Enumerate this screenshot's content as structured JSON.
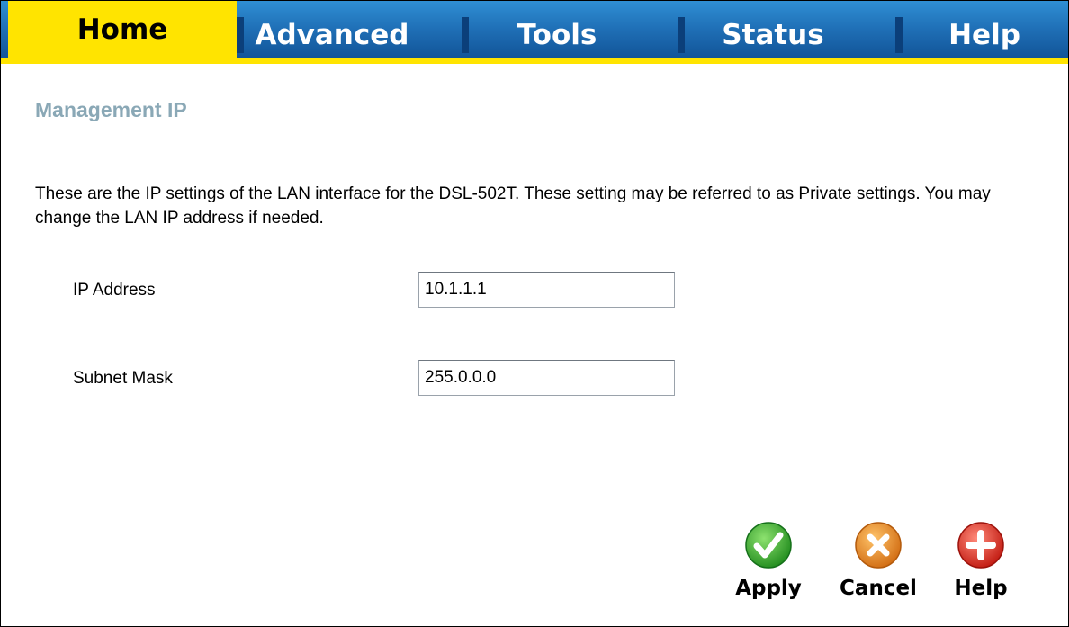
{
  "nav": {
    "tabs": [
      {
        "label": "Home",
        "active": true
      },
      {
        "label": "Advanced",
        "active": false
      },
      {
        "label": "Tools",
        "active": false
      },
      {
        "label": "Status",
        "active": false
      },
      {
        "label": "Help",
        "active": false
      }
    ]
  },
  "page": {
    "title": "Management IP",
    "description": "These are the IP settings of the LAN interface for the DSL-502T. These setting may be referred to as Private settings. You may change the LAN IP address if needed."
  },
  "form": {
    "ip_address": {
      "label": "IP Address",
      "value": "10.1.1.1"
    },
    "subnet_mask": {
      "label": "Subnet Mask",
      "value": "255.0.0.0"
    }
  },
  "actions": {
    "apply": {
      "label": "Apply",
      "icon": "check-icon",
      "color": "#2fa82b"
    },
    "cancel": {
      "label": "Cancel",
      "icon": "x-icon",
      "color": "#e8861c"
    },
    "help": {
      "label": "Help",
      "icon": "plus-icon",
      "color": "#d9261c"
    }
  },
  "colors": {
    "nav_blue": "#1f6fb6",
    "nav_active": "#ffe400",
    "title_gray": "#8aa8b6"
  }
}
